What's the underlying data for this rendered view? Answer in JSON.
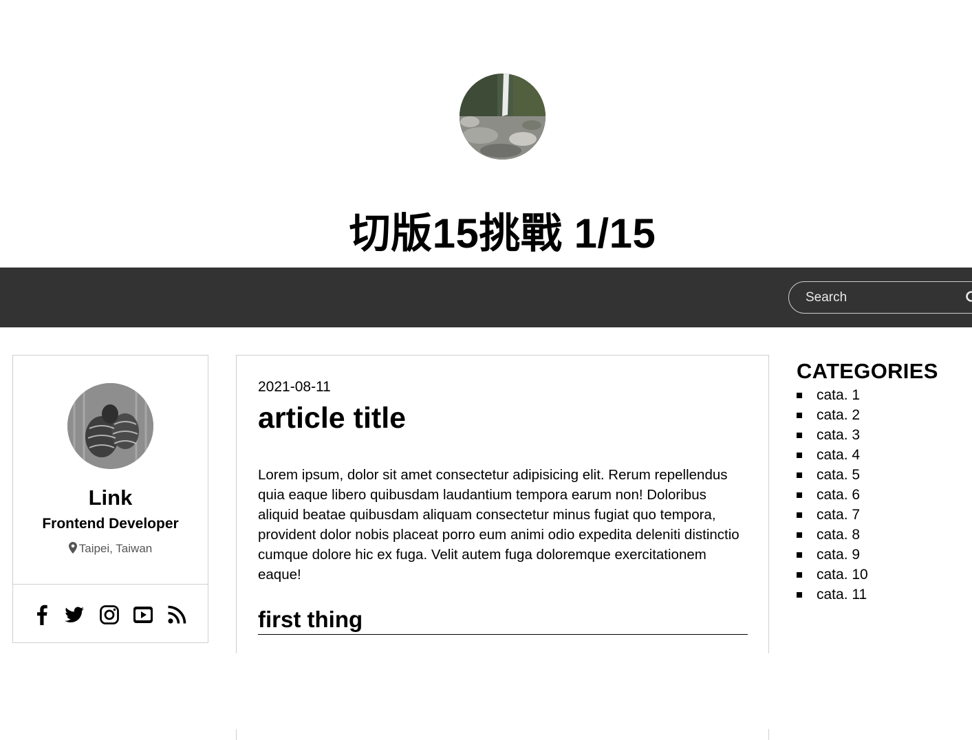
{
  "header": {
    "title": "切版15挑戰 1/15"
  },
  "navbar": {
    "search": {
      "placeholder": "Search",
      "value": ""
    }
  },
  "profile": {
    "name": "Link",
    "role": "Frontend Developer",
    "location": "Taipei, Taiwan",
    "social": [
      "facebook-icon",
      "twitter-icon",
      "instagram-icon",
      "youtube-icon",
      "rss-icon"
    ]
  },
  "article": {
    "date": "2021-08-11",
    "title": "article title",
    "body": "Lorem ipsum, dolor sit amet consectetur adipisicing elit. Rerum repellendus quia eaque libero quibusdam laudantium tempora earum non! Doloribus aliquid beatae quibusdam aliquam consectetur minus fugiat quo tempora, provident dolor nobis placeat porro eum animi odio expedita deleniti distinctio cumque dolore hic ex fuga. Velit autem fuga doloremque exercitationem eaque!",
    "section_heading": "first thing"
  },
  "categories": {
    "title": "CATEGORIES",
    "items": [
      {
        "label": "cata. 1"
      },
      {
        "label": "cata. 2"
      },
      {
        "label": "cata. 3"
      },
      {
        "label": "cata. 4"
      },
      {
        "label": "cata. 5"
      },
      {
        "label": "cata. 6"
      },
      {
        "label": "cata. 7"
      },
      {
        "label": "cata. 8"
      },
      {
        "label": "cata. 9"
      },
      {
        "label": "cata. 10"
      },
      {
        "label": "cata. 11"
      }
    ]
  },
  "colors": {
    "navbar_bg": "#333333",
    "border": "#cfcfcf",
    "text": "#000000"
  }
}
